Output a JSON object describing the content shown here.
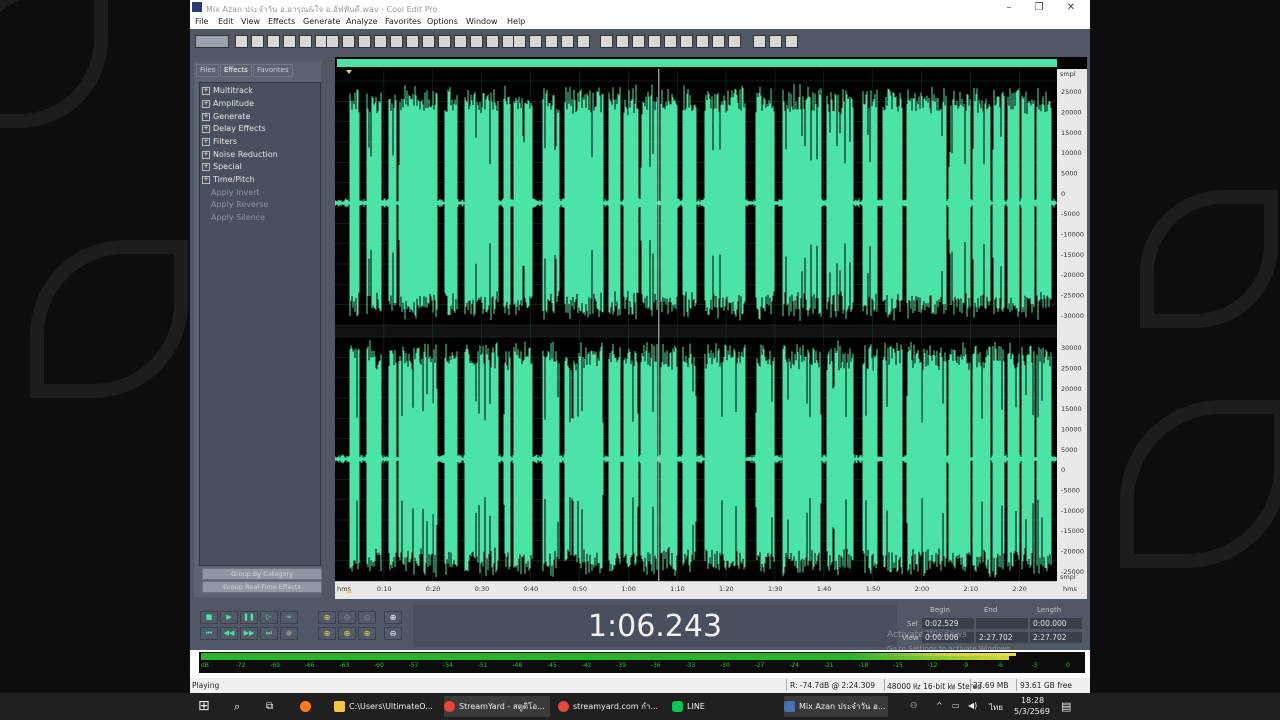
{
  "window": {
    "title": "Mix Azan ประจำวัน อ.อารุณ&ใจ อ.อัฟฟันดี.wav - Cool Edit Pro"
  },
  "menu": [
    "File",
    "Edit",
    "View",
    "Effects",
    "Generate",
    "Analyze",
    "Favorites",
    "Options",
    "Window",
    "Help"
  ],
  "panel": {
    "tabs": [
      "Files",
      "Effects",
      "Favorites"
    ],
    "tree": [
      "Multitrack",
      "Amplitude",
      "Generate",
      "Delay Effects",
      "Filters",
      "Noise Reduction",
      "Special",
      "Time/Pitch"
    ],
    "apply_items": [
      "Apply Invert",
      "Apply Reverse",
      "Apply Silence"
    ],
    "group_by_category": "Group By Category",
    "group_realtime": "Group Real-Time Effects"
  },
  "waveform": {
    "ruler_units": "hms",
    "time_ticks": [
      "0:10",
      "0:20",
      "0:30",
      "0:40",
      "0:50",
      "1:00",
      "1:10",
      "1:20",
      "1:30",
      "1:40",
      "1:50",
      "2:00",
      "2:10",
      "2:20"
    ],
    "amp_unit": "smpl",
    "amp_ticks": [
      "25000",
      "20000",
      "15000",
      "10000",
      "5000",
      "0",
      "-5000",
      "-10000",
      "-15000",
      "-20000",
      "-25000",
      "-30000"
    ],
    "amp_ticks_top2": [
      "30000",
      "25000",
      "20000",
      "15000",
      "10000",
      "5000",
      "0",
      "-5000",
      "-10000",
      "-15000",
      "-20000",
      "-25000"
    ],
    "color": "#4ce3a6",
    "total_seconds": 147.702,
    "cursor_seconds": 66.243
  },
  "time_display": "1:06.243",
  "selection": {
    "headers": [
      "Begin",
      "End",
      "Length"
    ],
    "sel_label": "Sel",
    "view_label": "View",
    "sel": [
      "0:02.529",
      "",
      "0:00.000"
    ],
    "view": [
      "0:00.006",
      "2:27.702",
      "2:27.702"
    ]
  },
  "meter": {
    "ticks": [
      "dB",
      "-72",
      "-69",
      "-66",
      "-63",
      "-60",
      "-57",
      "-54",
      "-51",
      "-48",
      "-45",
      "-42",
      "-39",
      "-36",
      "-33",
      "-30",
      "-27",
      "-24",
      "-21",
      "-18",
      "-15",
      "-12",
      "-9",
      "-6",
      "-3",
      "0"
    ]
  },
  "status": {
    "state": "Playing",
    "level": "R: -74.7dB @  2:24.309",
    "format": "48000 ㎐ 16-bit ㎾ Stereo",
    "size": "27.69 MB",
    "free": "93.61 GB free"
  },
  "watermark": {
    "line1": "Activate Windows",
    "line2": "Go to Settings to activate Windows."
  },
  "taskbar": {
    "items": [
      "C:\\Users\\UltimateO...",
      "StreamYard - สตูดิโอ...",
      "streamyard.com กำ...",
      "LINE",
      "Mix Azan ประจำวัน อ..."
    ],
    "lang": "ไทย",
    "time": "18:28",
    "date": "5/3/2569"
  }
}
